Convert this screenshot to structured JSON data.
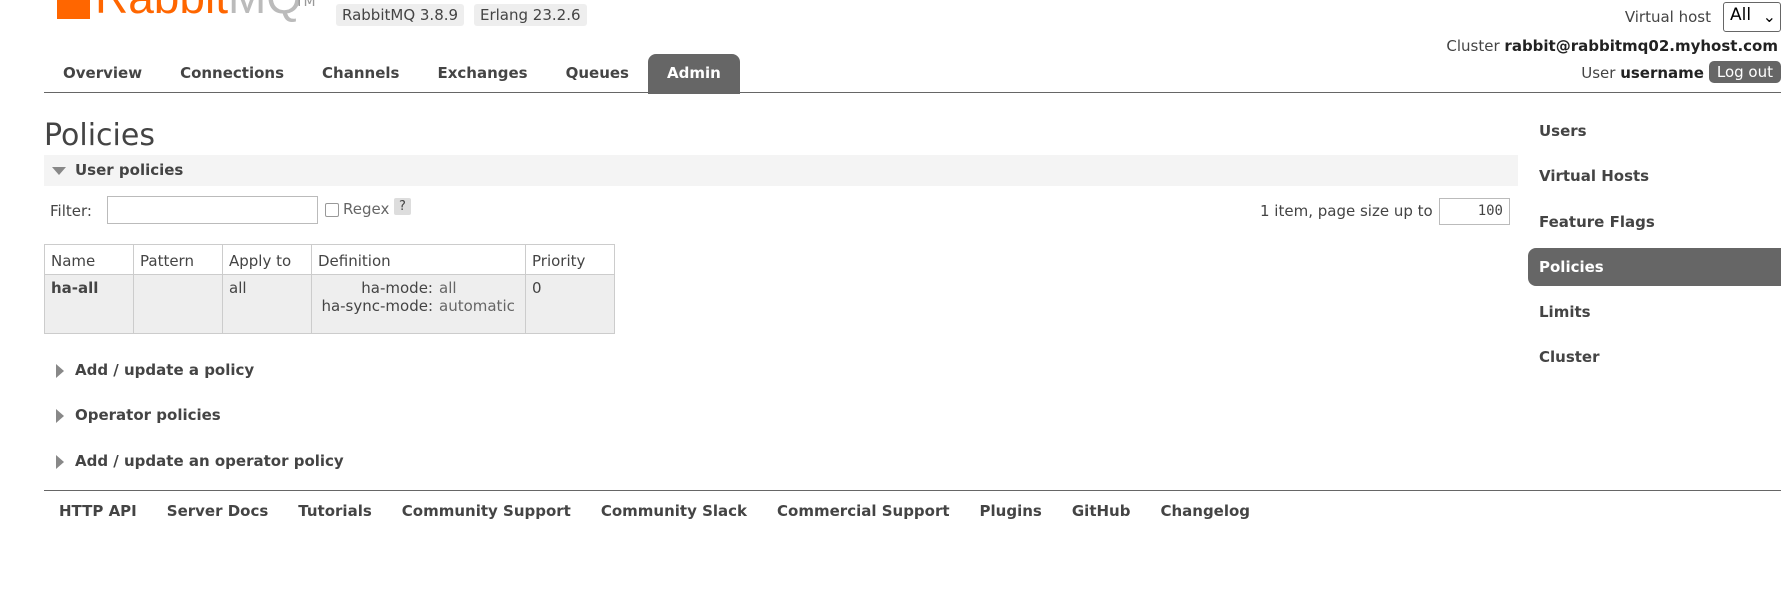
{
  "brand": {
    "name_main": "Rabbit",
    "name_suffix": "MQ",
    "tm": "TM",
    "rabbitmq_version": "RabbitMQ 3.8.9",
    "erlang_version": "Erlang 23.2.6",
    "brand_color": "#ff6600"
  },
  "header": {
    "vhost_label": "Virtual host",
    "vhost_value": "All",
    "cluster_label": "Cluster",
    "cluster_name": "rabbit@rabbitmq02.myhost.com",
    "user_label": "User",
    "user_name": "username",
    "logout_label": "Log out"
  },
  "tabs": [
    {
      "label": "Overview",
      "active": false
    },
    {
      "label": "Connections",
      "active": false
    },
    {
      "label": "Channels",
      "active": false
    },
    {
      "label": "Exchanges",
      "active": false
    },
    {
      "label": "Queues",
      "active": false
    },
    {
      "label": "Admin",
      "active": true
    }
  ],
  "page": {
    "title": "Policies",
    "user_policies": {
      "heading": "User policies",
      "filter_label": "Filter:",
      "filter_value": "",
      "regex_label": "Regex",
      "help_label": "?",
      "page_info": "1 item, page size up to",
      "page_size": "100",
      "columns": [
        "Name",
        "Pattern",
        "Apply to",
        "Definition",
        "Priority"
      ],
      "rows": [
        {
          "name": "ha-all",
          "pattern": "",
          "apply_to": "all",
          "definition": [
            {
              "key": "ha-mode:",
              "value": "all"
            },
            {
              "key": "ha-sync-mode:",
              "value": "automatic"
            }
          ],
          "priority": "0"
        }
      ]
    },
    "collapsed_sections": [
      "Add / update a policy",
      "Operator policies",
      "Add / update an operator policy"
    ]
  },
  "sidebar": {
    "items": [
      {
        "label": "Users",
        "active": false
      },
      {
        "label": "Virtual Hosts",
        "active": false
      },
      {
        "label": "Feature Flags",
        "active": false
      },
      {
        "label": "Policies",
        "active": true
      },
      {
        "label": "Limits",
        "active": false
      },
      {
        "label": "Cluster",
        "active": false
      }
    ]
  },
  "footer": {
    "links": [
      "HTTP API",
      "Server Docs",
      "Tutorials",
      "Community Support",
      "Community Slack",
      "Commercial Support",
      "Plugins",
      "GitHub",
      "Changelog"
    ]
  }
}
